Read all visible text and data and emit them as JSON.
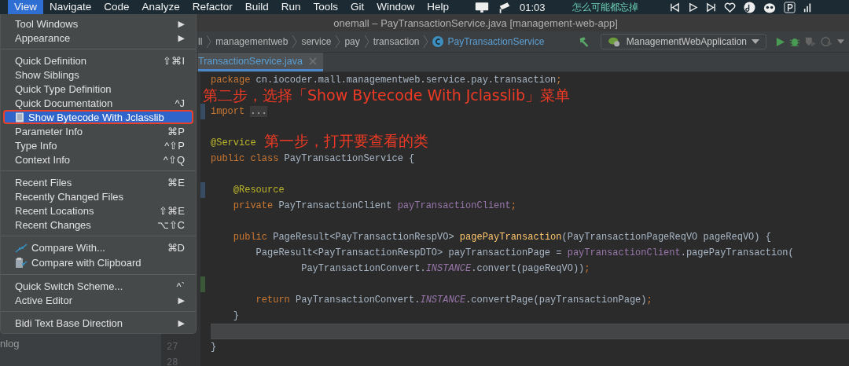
{
  "menu_bar": {
    "items": [
      {
        "label": "View",
        "selected": true
      },
      {
        "label": "Navigate",
        "selected": false
      },
      {
        "label": "Code",
        "selected": false
      },
      {
        "label": "Analyze",
        "selected": false
      },
      {
        "label": "Refactor",
        "selected": false
      },
      {
        "label": "Build",
        "selected": false
      },
      {
        "label": "Run",
        "selected": false
      },
      {
        "label": "Tools",
        "selected": false
      },
      {
        "label": "Git",
        "selected": false
      },
      {
        "label": "Window",
        "selected": false
      },
      {
        "label": "Help",
        "selected": false
      }
    ],
    "clock": "01:03",
    "now_playing": "怎么可能都忘掉"
  },
  "window": {
    "title": "onemall – PayTransactionService.java [management-web-app]"
  },
  "navigation_bar": {
    "crumbs": [
      "ll",
      "managementweb",
      "service",
      "pay",
      "transaction"
    ],
    "class_name": "PayTransactionService",
    "run_configuration": "ManagementWebApplication"
  },
  "editor_tab": {
    "label": "TransactionService.java"
  },
  "project_panel": {
    "items": [
      "nlog"
    ]
  },
  "view_menu": {
    "sections": [
      [
        {
          "label": "Tool Windows",
          "arrow": "▶",
          "selected": false,
          "outlined": false
        },
        {
          "label": "Appearance",
          "arrow": "▶",
          "selected": false,
          "outlined": false
        }
      ],
      [
        {
          "label": "Quick Definition",
          "shortcut": "⇧⌘I",
          "selected": false,
          "outlined": false
        },
        {
          "label": "Show Siblings",
          "selected": false,
          "outlined": false
        },
        {
          "label": "Quick Type Definition",
          "selected": false,
          "outlined": false
        },
        {
          "label": "Quick Documentation",
          "shortcut": "^J",
          "selected": false,
          "outlined": false
        },
        {
          "label": "Show Bytecode With Jclasslib",
          "kind": "bytecode",
          "selected": true,
          "outlined": true
        },
        {
          "label": "Parameter Info",
          "shortcut": "⌘P",
          "selected": false,
          "outlined": false
        },
        {
          "label": "Type Info",
          "shortcut": "^⇧P",
          "selected": false,
          "outlined": false
        },
        {
          "label": "Context Info",
          "shortcut": "^⇧Q",
          "selected": false,
          "outlined": false
        }
      ],
      [
        {
          "label": "Recent Files",
          "shortcut": "⌘E",
          "selected": false,
          "outlined": false
        },
        {
          "label": "Recently Changed Files",
          "selected": false,
          "outlined": false
        },
        {
          "label": "Recent Locations",
          "shortcut": "⇧⌘E",
          "selected": false,
          "outlined": false
        },
        {
          "label": "Recent Changes",
          "shortcut": "⌥⇧C",
          "selected": false,
          "outlined": false
        }
      ],
      [
        {
          "label": "Compare With...",
          "kind": "compare",
          "shortcut": "⌘D",
          "selected": false,
          "outlined": false
        },
        {
          "label": "Compare with Clipboard",
          "kind": "clipboard",
          "selected": false,
          "outlined": false
        }
      ],
      [
        {
          "label": "Quick Switch Scheme...",
          "shortcut": "^`",
          "selected": false,
          "outlined": false
        },
        {
          "label": "Active Editor",
          "arrow": "▶",
          "selected": false,
          "outlined": false
        }
      ],
      [
        {
          "label": "Bidi Text Base Direction",
          "arrow": "▶",
          "selected": false,
          "outlined": false
        }
      ]
    ]
  },
  "code_lines": [
    {
      "current": false,
      "tokens": [
        {
          "kind": "keyword",
          "text": "package"
        },
        {
          "kind": "plain",
          "text": " cn.iocoder.mall.managementweb.service.pay.transaction"
        },
        {
          "kind": "punct",
          "text": ";"
        }
      ]
    },
    {
      "current": false
    },
    {
      "current": false,
      "color": "#374c63",
      "tokens": [
        {
          "kind": "keyword",
          "text": "import"
        },
        {
          "kind": "folded",
          "text": "..."
        }
      ]
    },
    {
      "current": false
    },
    {
      "current": false,
      "tokens": [
        {
          "kind": "annotation",
          "text": "@Service"
        }
      ]
    },
    {
      "current": false,
      "tokens": [
        {
          "kind": "keyword",
          "text": "public class"
        },
        {
          "kind": "plain",
          "text": " PayTransactionService {"
        }
      ]
    },
    {
      "current": false
    },
    {
      "current": false,
      "color": "#374c63",
      "tokens": [
        {
          "kind": "annotation",
          "text": "    @Resource"
        }
      ]
    },
    {
      "current": false,
      "tokens": [
        {
          "kind": "keyword",
          "text": "    private"
        },
        {
          "kind": "plain",
          "text": " PayTransactionClient "
        },
        {
          "kind": "field",
          "text": "payTransactionClient"
        },
        {
          "kind": "punct",
          "text": ";"
        }
      ]
    },
    {
      "current": false
    },
    {
      "current": false,
      "tokens": [
        {
          "kind": "keyword",
          "text": "    public"
        },
        {
          "kind": "plain",
          "text": " PageResult<PayTransactionRespVO> "
        },
        {
          "kind": "method",
          "text": "pagePayTransaction"
        },
        {
          "kind": "plain",
          "text": "(PayTransactionPageReqVO pageReqVO) {"
        }
      ]
    },
    {
      "current": false,
      "tokens": [
        {
          "kind": "plain",
          "text": "        PageResult<PayTransactionRespDTO> payTransactionPage = "
        },
        {
          "kind": "field",
          "text": "payTransactionClient"
        },
        {
          "kind": "plain",
          "text": ".pagePayTransaction("
        }
      ]
    },
    {
      "current": false,
      "tokens": [
        {
          "kind": "plain",
          "text": "                PayTransactionConvert."
        },
        {
          "kind": "static",
          "text": "INSTANCE"
        },
        {
          "kind": "plain",
          "text": ".convert(pageReqVO))"
        },
        {
          "kind": "punct",
          "text": ";"
        }
      ]
    },
    {
      "current": false,
      "color": "#3b5838"
    },
    {
      "current": false,
      "tokens": [
        {
          "kind": "keyword",
          "text": "        return"
        },
        {
          "kind": "plain",
          "text": " PayTransactionConvert."
        },
        {
          "kind": "static",
          "text": "INSTANCE"
        },
        {
          "kind": "plain",
          "text": ".convertPage(payTransactionPage)"
        },
        {
          "kind": "punct",
          "text": ";"
        }
      ]
    },
    {
      "current": false,
      "tokens": [
        {
          "kind": "plain",
          "text": "    }"
        }
      ]
    },
    {
      "current": true
    },
    {
      "current": false,
      "number": "27",
      "tokens": [
        {
          "kind": "plain",
          "text": "}"
        }
      ]
    },
    {
      "current": false,
      "number": "28"
    }
  ],
  "annotations": [
    {
      "text": "第二步，选择「Show Bytecode With Jclasslib」菜单"
    },
    {
      "text": "第一步，打开要查看的类"
    }
  ]
}
